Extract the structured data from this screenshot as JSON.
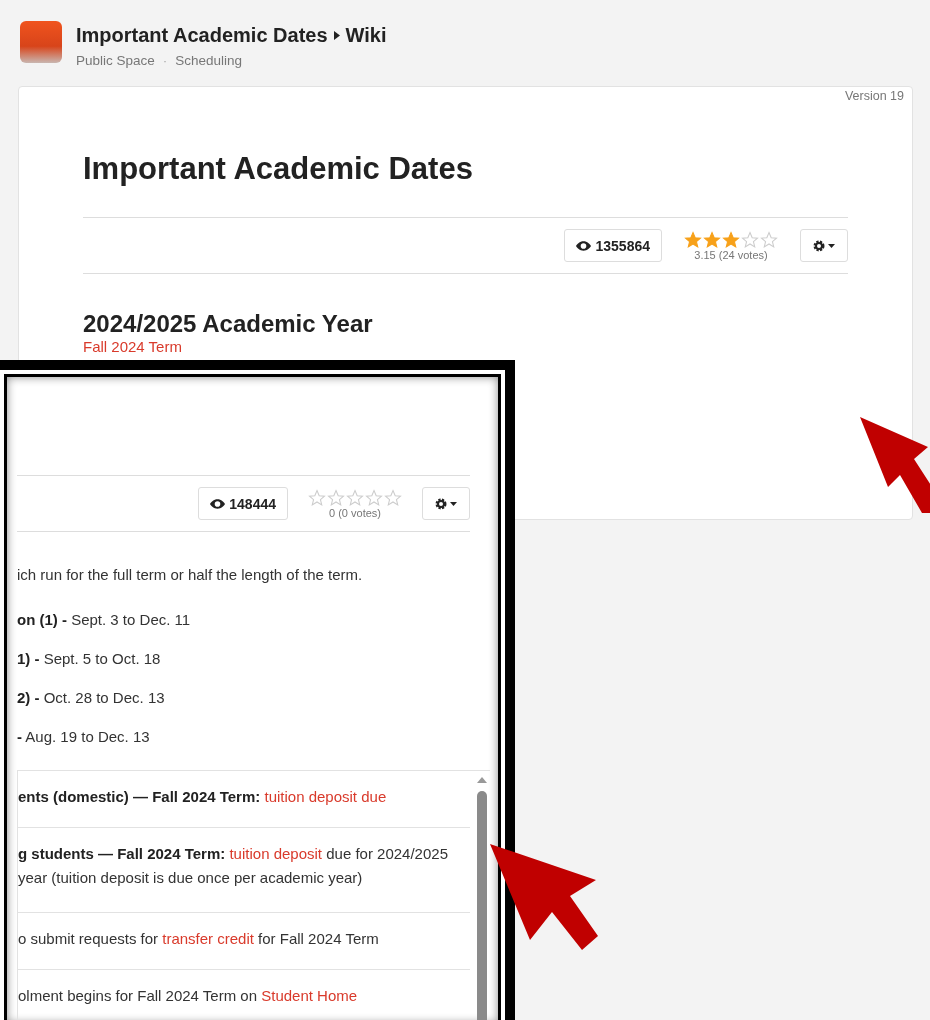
{
  "header": {
    "title": "Important Academic Dates",
    "section": "Wiki",
    "breadcrumb": [
      "Public Space",
      "Scheduling"
    ],
    "separator": "·"
  },
  "page": {
    "version": "Version 19",
    "title": "Important Academic Dates",
    "views": "1355864",
    "rating": {
      "stars": 3,
      "summary": "3.15 (24 votes)"
    },
    "heading": "2024/2025 Academic Year",
    "term_link": "Fall 2024 Term"
  },
  "inset": {
    "views": "148444",
    "rating": {
      "stars": 0,
      "summary": "0 (0 votes)"
    },
    "intro": "ich run for the full term or half the length of the term.",
    "periods": [
      {
        "label": "on (1) -",
        "dates": "Sept. 3 to Dec. 11"
      },
      {
        "label": "1) -",
        "dates": "Sept. 5 to Oct. 18"
      },
      {
        "label": "2) -",
        "dates": "Oct. 28 to Dec. 13"
      },
      {
        "label": "-",
        "dates": "Aug. 19 to Dec. 13"
      }
    ],
    "rows": [
      {
        "lines": [
          [
            {
              "kind": "bold",
              "text": "ents (domestic) — Fall 2024 Term:"
            },
            {
              "kind": "link",
              "text": "tuition deposit due"
            }
          ]
        ]
      },
      {
        "lines": [
          [
            {
              "kind": "bold",
              "text": "g students — Fall 2024 Term:"
            },
            {
              "kind": "link",
              "text": "tuition deposit"
            },
            {
              "kind": "plain",
              "text": "due for 2024/2025"
            }
          ],
          [
            {
              "kind": "plain",
              "text": "year (tuition deposit is due once per academic year)"
            }
          ]
        ]
      },
      {
        "lines": [
          [
            {
              "kind": "plain",
              "text": "o submit requests for"
            },
            {
              "kind": "link",
              "text": "transfer credit"
            },
            {
              "kind": "plain",
              "text": "for Fall 2024 Term"
            }
          ]
        ]
      },
      {
        "lines": [
          [
            {
              "kind": "plain",
              "text": "olment begins for Fall 2024 Term on"
            },
            {
              "kind": "link",
              "text": "Student Home"
            }
          ]
        ]
      }
    ]
  }
}
